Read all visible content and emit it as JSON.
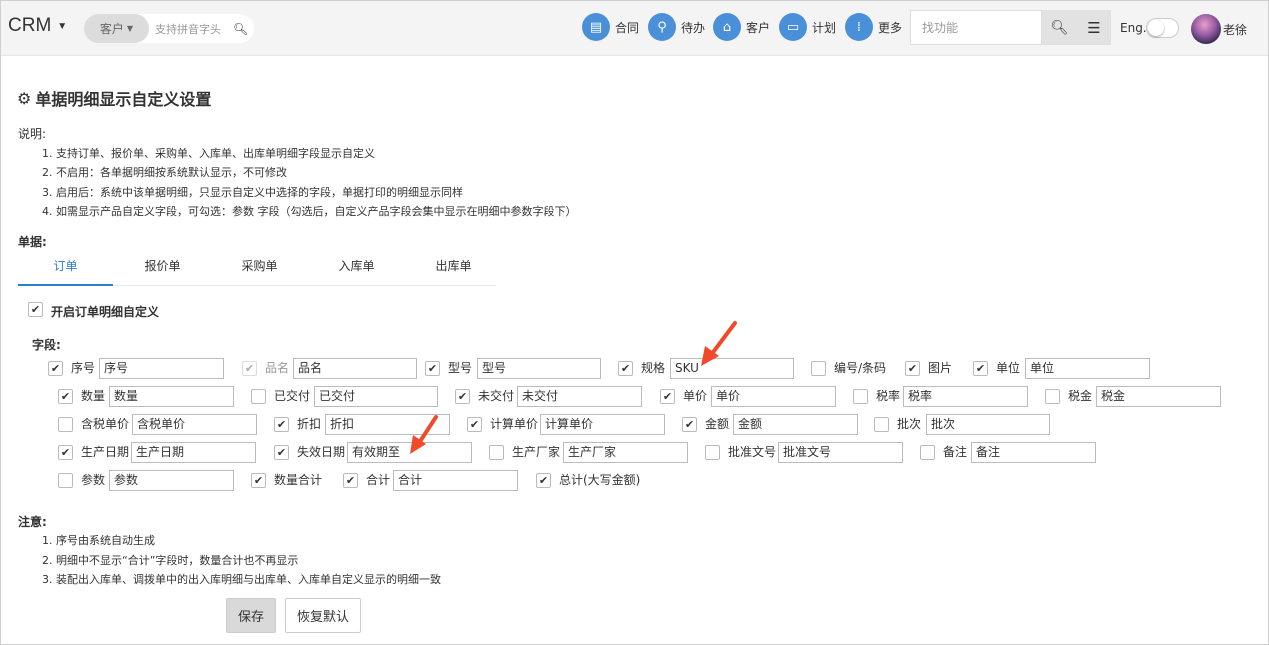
{
  "topbar": {
    "brand": "CRM",
    "search": {
      "selector": "客户",
      "placeholder": "支持拼音字头"
    },
    "nav": [
      {
        "label": "合同",
        "icon": "document-icon"
      },
      {
        "label": "待办",
        "icon": "walking-person-icon"
      },
      {
        "label": "客户",
        "icon": "bank-icon"
      },
      {
        "label": "计划",
        "icon": "ticket-icon"
      },
      {
        "label": "更多",
        "icon": "grid-icon"
      }
    ],
    "find_placeholder": "找功能",
    "lang_label": "Eng.",
    "username": "老徐"
  },
  "page": {
    "title": "单据明细显示自定义设置",
    "desc_label": "说明:",
    "desc": [
      "1. 支持订单、报价单、采购单、入库单、出库单明细字段显示自定义",
      "2. 不启用：各单据明细按系统默认显示，不可修改",
      "3. 启用后：系统中该单据明细，只显示自定义中选择的字段，单据打印的明细显示同样",
      "4. 如需显示产品自定义字段，可勾选：参数 字段（勾选后，自定义产品字段会集中显示在明细中参数字段下）"
    ],
    "docs_label": "单据:",
    "tabs": [
      "订单",
      "报价单",
      "采购单",
      "入库单",
      "出库单"
    ],
    "active_tab": "订单",
    "enable_label": "开启订单明细自定义",
    "enabled": true,
    "fields_label": "字段:",
    "fields": [
      {
        "label": "序号",
        "checked": true,
        "value": "序号"
      },
      {
        "label": "品名",
        "checked": true,
        "disabled": true,
        "value": "品名"
      },
      {
        "label": "型号",
        "checked": true,
        "value": "型号"
      },
      {
        "label": "规格",
        "checked": true,
        "value": "SKU"
      },
      {
        "label": "编号/条码",
        "checked": false
      },
      {
        "label": "图片",
        "checked": true
      },
      {
        "label": "单位",
        "checked": true,
        "value": "单位"
      },
      {
        "label": "数量",
        "checked": true,
        "value": "数量"
      },
      {
        "label": "已交付",
        "checked": false,
        "value": "已交付"
      },
      {
        "label": "未交付",
        "checked": true,
        "value": "未交付"
      },
      {
        "label": "单价",
        "checked": true,
        "value": "单价"
      },
      {
        "label": "税率",
        "checked": false,
        "value": "税率"
      },
      {
        "label": "税金",
        "checked": false,
        "value": "税金"
      },
      {
        "label": "含税单价",
        "checked": false,
        "value": "含税单价"
      },
      {
        "label": "折扣",
        "checked": true,
        "value": "折扣"
      },
      {
        "label": "计算单价",
        "checked": true,
        "value": "计算单价"
      },
      {
        "label": "金额",
        "checked": true,
        "value": "金额"
      },
      {
        "label": "批次",
        "checked": false,
        "value": "批次"
      },
      {
        "label": "生产日期",
        "checked": true,
        "value": "生产日期"
      },
      {
        "label": "失效日期",
        "checked": true,
        "value": "有效期至"
      },
      {
        "label": "生产厂家",
        "checked": false,
        "value": "生产厂家"
      },
      {
        "label": "批准文号",
        "checked": false,
        "value": "批准文号"
      },
      {
        "label": "备注",
        "checked": false,
        "value": "备注"
      },
      {
        "label": "参数",
        "checked": false,
        "value": "参数"
      },
      {
        "label": "数量合计",
        "checked": true
      },
      {
        "label": "合计",
        "checked": true,
        "value": "合计"
      },
      {
        "label": "总计(大写金额)",
        "checked": true
      }
    ],
    "notes_label": "注意:",
    "notes": [
      "1. 序号由系统自动生成",
      "2. 明细中不显示“合计”字段时，数量合计也不再显示",
      "3. 装配出入库单、调拨单中的出入库明细与出库单、入库单自定义显示的明细一致"
    ],
    "save_label": "保存",
    "reset_label": "恢复默认"
  },
  "colors": {
    "accent": "#2a7fd4",
    "nav_icon": "#4a90d9",
    "arrow": "#f04a2a"
  }
}
